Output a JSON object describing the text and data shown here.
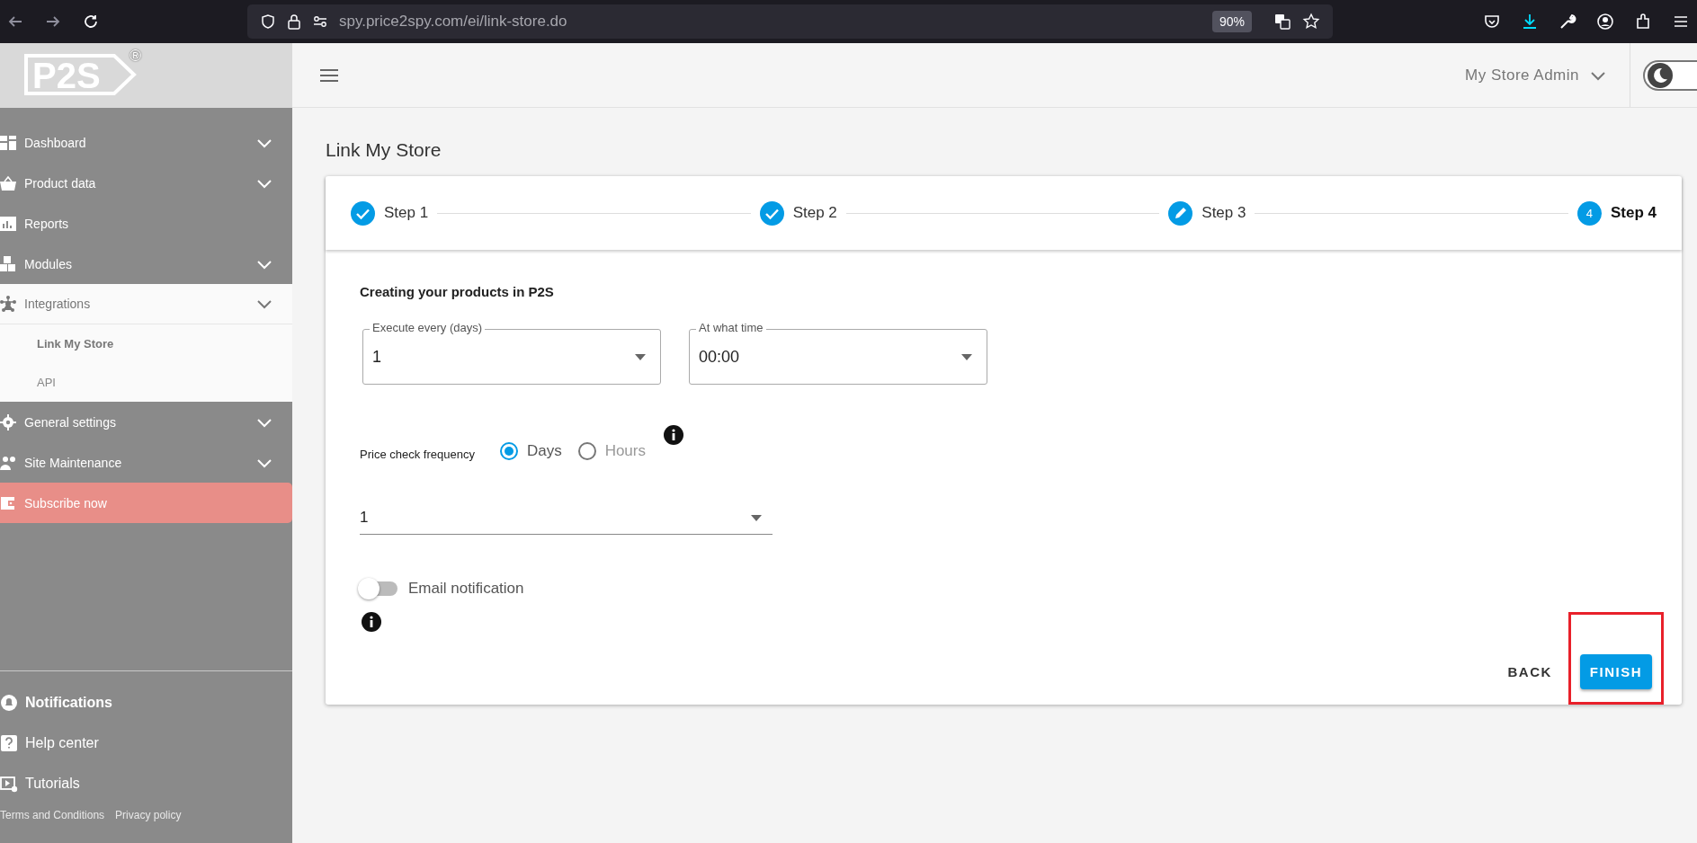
{
  "browser": {
    "url": "spy.price2spy.com/ei/link-store.do",
    "zoom": "90%"
  },
  "header": {
    "logo": "P2S",
    "logo_mark": "®",
    "user": "My Store Admin",
    "dark_mode": false
  },
  "sidebar": {
    "items": [
      {
        "label": "Dashboard",
        "kind": "group",
        "expanded": false
      },
      {
        "label": "Product data",
        "kind": "group",
        "expanded": false
      },
      {
        "label": "Reports",
        "kind": "link",
        "expanded": false
      },
      {
        "label": "Modules",
        "kind": "group",
        "expanded": false
      },
      {
        "label": "Integrations",
        "kind": "group",
        "expanded": true,
        "children": [
          {
            "label": "Link My Store",
            "selected": true
          },
          {
            "label": "API",
            "selected": false
          }
        ]
      },
      {
        "label": "General settings",
        "kind": "group",
        "expanded": false
      },
      {
        "label": "Site Maintenance",
        "kind": "group",
        "expanded": false
      },
      {
        "label": "Subscribe now",
        "kind": "promo",
        "expanded": false
      }
    ],
    "bottom": [
      {
        "label": "Notifications",
        "bold": true
      },
      {
        "label": "Help center",
        "bold": false
      },
      {
        "label": "Tutorials",
        "bold": false
      }
    ],
    "legal": [
      "Terms and Conditions",
      "Privacy policy"
    ]
  },
  "page": {
    "title": "Link My Store"
  },
  "steps": [
    {
      "label": "Step 1",
      "kind": "done"
    },
    {
      "label": "Step 2",
      "kind": "done"
    },
    {
      "label": "Step 3",
      "kind": "editing"
    },
    {
      "label": "Step 4",
      "kind": "current",
      "number": "4"
    }
  ],
  "form": {
    "section_title": "Creating your products in P2S",
    "fields": [
      {
        "label": "Execute every (days)",
        "value": "1"
      },
      {
        "label": "At what time",
        "value": "00:00"
      }
    ],
    "frequency_label": "Price check frequency",
    "radios": [
      {
        "label": "Days",
        "selected": true
      },
      {
        "label": "Hours",
        "selected": false
      }
    ],
    "frequency_value": "1",
    "toggle": {
      "label": "Email notification",
      "on": false
    }
  },
  "actions": {
    "back": "BACK",
    "finish": "FINISH",
    "finish_highlighted": true
  }
}
